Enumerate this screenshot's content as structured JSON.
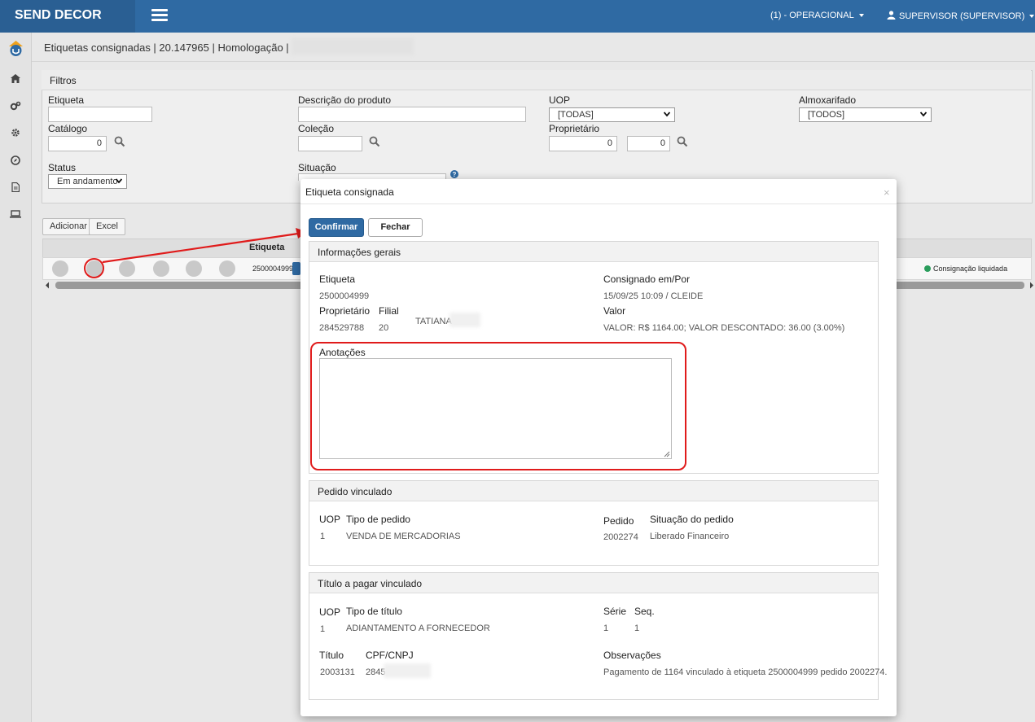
{
  "app": {
    "brand": "SEND DECOR",
    "company_menu": "(1) - OPERACIONAL",
    "user_menu": "SUPERVISOR (SUPERVISOR)"
  },
  "breadcrumb": "Etiquetas consignadas | 20.147965 | Homologação |",
  "filters": {
    "title": "Filtros",
    "etiqueta_label": "Etiqueta",
    "etiqueta_value": "",
    "descricao_label": "Descrição do produto",
    "descricao_value": "",
    "uop_label": "UOP",
    "uop_value": "[TODAS]",
    "almox_label": "Almoxarifado",
    "almox_value": "[TODOS]",
    "catalogo_label": "Catálogo",
    "catalogo_value": "0",
    "colecao_label": "Coleção",
    "colecao_value": "",
    "proprietario_label": "Proprietário",
    "proprietario_value1": "0",
    "proprietario_value2": "0",
    "status_label": "Status",
    "status_value": "Em andamento",
    "situacao_label": "Situação"
  },
  "grid": {
    "add_label": "Adicionar",
    "excel_label": "Excel",
    "col_etiqueta": "Etiqueta",
    "row_etiqueta": "2500004999",
    "row_status": "Consignação liquidada",
    "status_color": "#2a9d5c"
  },
  "modal": {
    "title": "Etiqueta consignada",
    "close_glyph": "×",
    "confirm_label": "Confirmar",
    "close_label": "Fechar",
    "general": {
      "title": "Informações gerais",
      "etiqueta_label": "Etiqueta",
      "etiqueta_value": "2500004999",
      "consignado_label": "Consignado em/Por",
      "consignado_value": "15/09/25 10:09 / CLEIDE",
      "proprietario_label": "Proprietário",
      "proprietario_value": "284529788",
      "filial_label": "Filial",
      "filial_value": "20",
      "nome_value": "TATIANA",
      "valor_label": "Valor",
      "valor_value": "VALOR: R$ 1164.00; VALOR DESCONTADO: 36.00 (3.00%)",
      "anotacoes_label": "Anotações",
      "anotacoes_value": ""
    },
    "pedido": {
      "title": "Pedido vinculado",
      "uop_label": "UOP",
      "uop_value": "1",
      "tipo_label": "Tipo de pedido",
      "tipo_value": "VENDA DE MERCADORIAS",
      "pedido_label": "Pedido",
      "pedido_value": "2002274",
      "situacao_label": "Situação do pedido",
      "situacao_value": "Liberado Financeiro"
    },
    "titulo": {
      "title": "Título a pagar vinculado",
      "uop_label": "UOP",
      "uop_value": "1",
      "tipo_label": "Tipo de título",
      "tipo_value": "ADIANTAMENTO A FORNECEDOR",
      "serie_label": "Série",
      "serie_value": "1",
      "seq_label": "Seq.",
      "seq_value": "1",
      "titulo_label": "Título",
      "titulo_value": "2003131",
      "cpf_label": "CPF/CNPJ",
      "cpf_value": "2845",
      "obs_label": "Observações",
      "obs_value": "Pagamento de 1164 vinculado à etiqueta 2500004999 pedido 2002274."
    }
  },
  "colors": {
    "primary": "#2f6aa3",
    "annotation_red": "#e01b1b"
  }
}
